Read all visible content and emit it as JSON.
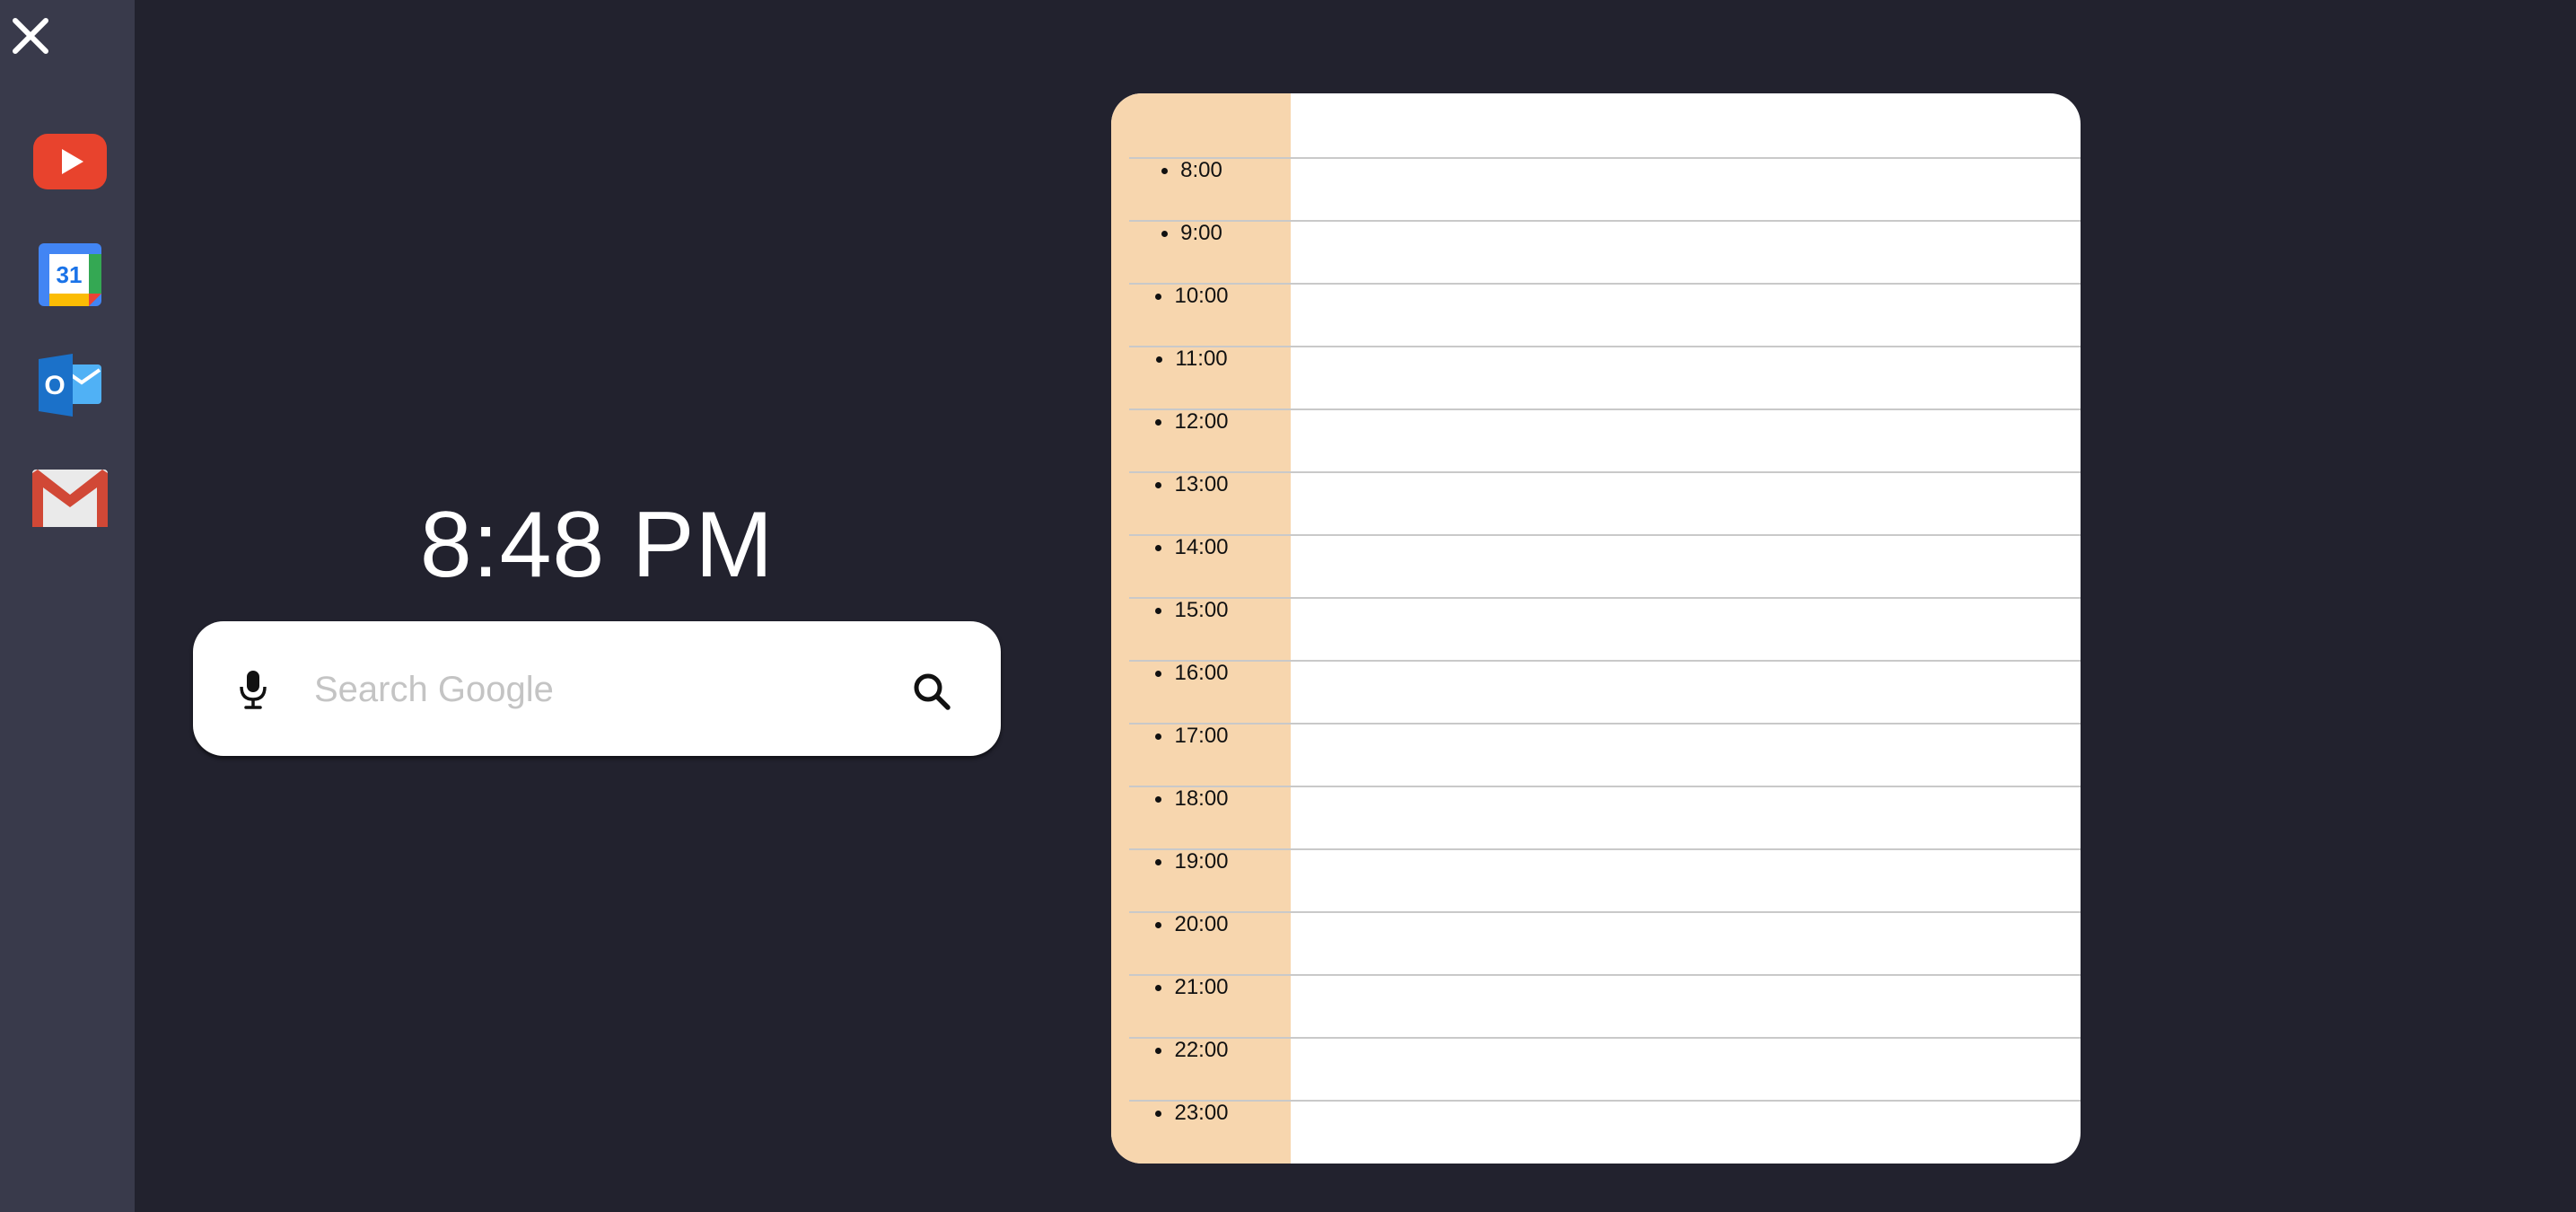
{
  "sidebar": {
    "close_icon": "close-icon",
    "apps": [
      {
        "name": "YouTube",
        "icon": "youtube-icon",
        "color": "#e8432d"
      },
      {
        "name": "Google Calendar",
        "icon": "google-calendar-icon",
        "day": "31"
      },
      {
        "name": "Outlook",
        "icon": "outlook-icon",
        "letter": "O",
        "color": "#1b71c9"
      },
      {
        "name": "Gmail",
        "icon": "gmail-icon",
        "color": "#d14836"
      }
    ]
  },
  "clock": {
    "time": "8:48 PM"
  },
  "search": {
    "placeholder": "Search Google",
    "value": "",
    "mic_icon": "microphone-icon",
    "search_icon": "search-icon"
  },
  "calendar": {
    "hours": [
      "8:00",
      "9:00",
      "10:00",
      "11:00",
      "12:00",
      "13:00",
      "14:00",
      "15:00",
      "16:00",
      "17:00",
      "18:00",
      "19:00",
      "20:00",
      "21:00",
      "22:00",
      "23:00"
    ],
    "time_column_color": "#f7d6ae"
  },
  "colors": {
    "background": "#22222e",
    "sidebar": "#393a4b"
  }
}
